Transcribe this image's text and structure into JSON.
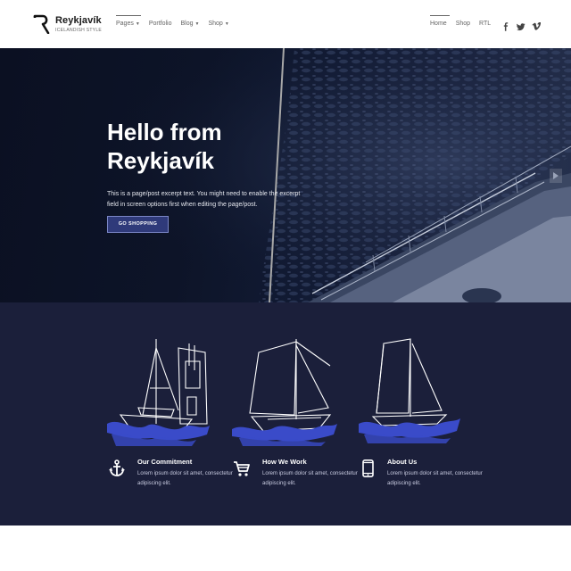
{
  "brand": {
    "title": "Reykjavík",
    "subtitle": "ICELANDISH STYLE"
  },
  "nav": {
    "left": [
      {
        "label": "Pages",
        "caret": "▼"
      },
      {
        "label": "Portfolio",
        "caret": ""
      },
      {
        "label": "Blog",
        "caret": "▼"
      },
      {
        "label": "Shop",
        "caret": "▼"
      }
    ],
    "right": [
      {
        "label": "Home"
      },
      {
        "label": "Shop"
      },
      {
        "label": "RTL"
      }
    ],
    "social": [
      "facebook-icon",
      "twitter-icon",
      "vimeo-icon"
    ]
  },
  "hero": {
    "title": "Hello from Reykjavík",
    "text": "This is a page/post excerpt text. You might need to enable the excerpt field in screen options first when editing the page/post.",
    "button": "GO SHOPPING"
  },
  "features": [
    {
      "title": "Our Commitment",
      "text": "Lorem ipsum dolor sit amet, consectetur adipiscing elit.",
      "icon": "anchor-icon"
    },
    {
      "title": "How We Work",
      "text": "Lorem ipsum dolor sit amet, consectetur adipiscing elit.",
      "icon": "cart-icon"
    },
    {
      "title": "About Us",
      "text": "Lorem ipsum dolor sit amet, consectetur adipiscing elit.",
      "icon": "phone-icon"
    }
  ],
  "colors": {
    "accent": "#2f3a7a",
    "features_bg": "#1b1f3a",
    "wave": "#3a4bc9"
  }
}
